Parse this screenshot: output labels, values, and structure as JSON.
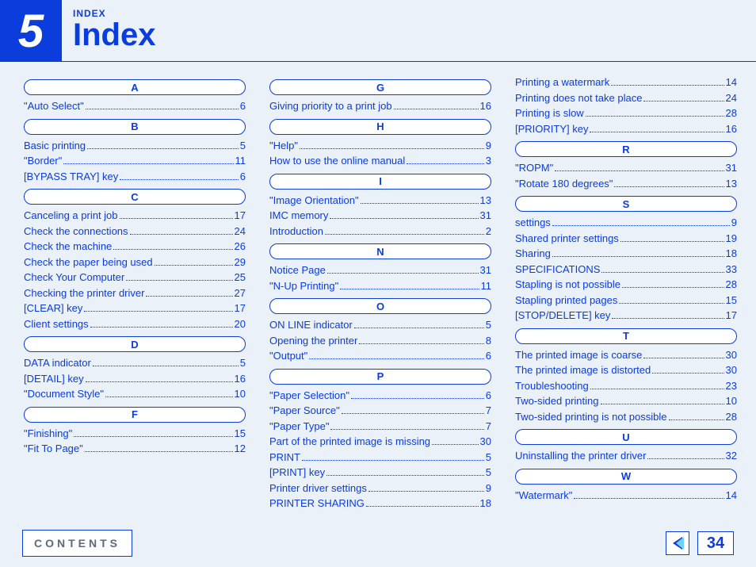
{
  "header": {
    "chapter": "5",
    "eyebrow": "INDEX",
    "title": "Index"
  },
  "footer": {
    "contents": "CONTENTS",
    "page": "34"
  },
  "columns": [
    [
      {
        "letter": "A",
        "items": [
          {
            "label": "\"Auto Select\"",
            "page": "6"
          }
        ]
      },
      {
        "letter": "B",
        "items": [
          {
            "label": "Basic printing",
            "page": "5"
          },
          {
            "label": "\"Border\"",
            "page": "11"
          },
          {
            "label": "[BYPASS TRAY] key",
            "page": "6"
          }
        ]
      },
      {
        "letter": "C",
        "items": [
          {
            "label": "Canceling a print job",
            "page": "17"
          },
          {
            "label": "Check the connections",
            "page": "24"
          },
          {
            "label": "Check the machine",
            "page": "26"
          },
          {
            "label": "Check the paper being used",
            "page": "29"
          },
          {
            "label": "Check Your Computer",
            "page": "25"
          },
          {
            "label": "Checking the printer driver",
            "page": "27"
          },
          {
            "label": "[CLEAR] key",
            "page": "17"
          },
          {
            "label": "Client settings",
            "page": "20"
          }
        ]
      },
      {
        "letter": "D",
        "items": [
          {
            "label": "DATA indicator",
            "page": "5"
          },
          {
            "label": "[DETAIL] key",
            "page": "16"
          },
          {
            "label": "\"Document Style\"",
            "page": "10"
          }
        ]
      },
      {
        "letter": "F",
        "items": [
          {
            "label": "\"Finishing\"",
            "page": "15"
          },
          {
            "label": "\"Fit To Page\"",
            "page": "12"
          }
        ]
      }
    ],
    [
      {
        "letter": "G",
        "items": [
          {
            "label": "Giving priority to a print job",
            "page": "16"
          }
        ]
      },
      {
        "letter": "H",
        "items": [
          {
            "label": "\"Help\"",
            "page": "9"
          },
          {
            "label": "How to use the online manual",
            "page": "3"
          }
        ]
      },
      {
        "letter": "I",
        "items": [
          {
            "label": "\"Image Orientation\"",
            "page": "13"
          },
          {
            "label": "IMC memory",
            "page": "31"
          },
          {
            "label": "Introduction",
            "page": "2"
          }
        ]
      },
      {
        "letter": "N",
        "items": [
          {
            "label": "Notice Page",
            "page": "31"
          },
          {
            "label": "\"N-Up Printing\"",
            "page": "11"
          }
        ]
      },
      {
        "letter": "O",
        "items": [
          {
            "label": "ON LINE indicator",
            "page": "5"
          },
          {
            "label": "Opening the printer",
            "page": "8"
          },
          {
            "label": "\"Output\"",
            "page": "6"
          }
        ]
      },
      {
        "letter": "P",
        "items": [
          {
            "label": "\"Paper Selection\"",
            "page": "6"
          },
          {
            "label": "\"Paper Source\"",
            "page": "7"
          },
          {
            "label": "\"Paper Type\"",
            "page": "7"
          },
          {
            "label": "Part of the printed image is missing",
            "page": "30"
          },
          {
            "label": "PRINT",
            "page": "5"
          },
          {
            "label": "[PRINT] key",
            "page": "5"
          },
          {
            "label": "Printer driver settings",
            "page": "9"
          },
          {
            "label": "PRINTER SHARING",
            "page": "18"
          }
        ]
      }
    ],
    [
      {
        "letter": "",
        "items": [
          {
            "label": "Printing a watermark",
            "page": "14"
          },
          {
            "label": "Printing does not take place",
            "page": "24"
          },
          {
            "label": "Printing is slow",
            "page": "28"
          },
          {
            "label": "[PRIORITY] key",
            "page": "16"
          }
        ]
      },
      {
        "letter": "R",
        "items": [
          {
            "label": "\"ROPM\"",
            "page": "31"
          },
          {
            "label": "\"Rotate 180 degrees\"",
            "page": "13"
          }
        ]
      },
      {
        "letter": "S",
        "items": [
          {
            "label": "settings",
            "page": "9"
          },
          {
            "label": "Shared printer settings",
            "page": "19"
          },
          {
            "label": "Sharing",
            "page": "18"
          },
          {
            "label": "SPECIFICATIONS",
            "page": "33"
          },
          {
            "label": "Stapling is not possible",
            "page": "28"
          },
          {
            "label": "Stapling printed pages",
            "page": "15"
          },
          {
            "label": "[STOP/DELETE] key",
            "page": "17"
          }
        ]
      },
      {
        "letter": "T",
        "items": [
          {
            "label": "The printed image is coarse",
            "page": "30"
          },
          {
            "label": "The printed image is distorted",
            "page": "30"
          },
          {
            "label": "Troubleshooting",
            "page": "23"
          },
          {
            "label": "Two-sided printing",
            "page": "10"
          },
          {
            "label": "Two-sided printing is not possible",
            "page": "28"
          }
        ]
      },
      {
        "letter": "U",
        "items": [
          {
            "label": "Uninstalling the printer driver",
            "page": "32"
          }
        ]
      },
      {
        "letter": "W",
        "items": [
          {
            "label": "\"Watermark\"",
            "page": "14"
          }
        ]
      }
    ]
  ]
}
